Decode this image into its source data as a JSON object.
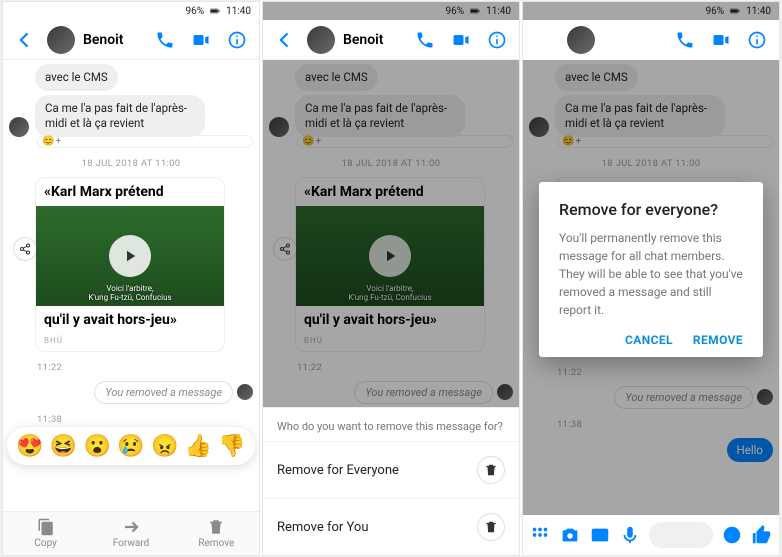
{
  "status": {
    "pct": "96%",
    "time": "11:40"
  },
  "contact": "Benoit",
  "msg": {
    "m1": "avec le CMS",
    "m2": "Ca me l'a pas fait de l'après-midi et là ça revient"
  },
  "ts1": "18 JUL 2018 AT 11:00",
  "card": {
    "top": "«Karl Marx prétend",
    "cap1": "Voici l'arbitre,",
    "cap2": "K'ung Fu-tzû, Confucius",
    "bot": "qu'il y avait hors-jeu»",
    "brand": "BHÜ"
  },
  "ts2": "11:22",
  "removed": "You removed a message",
  "ts3": "11:38",
  "hello": "Hello",
  "reactions": [
    "😍",
    "😆",
    "😮",
    "😢",
    "😠",
    "👍",
    "👎"
  ],
  "bbar": {
    "copy": "Copy",
    "forward": "Forward",
    "remove": "Remove"
  },
  "sheet": {
    "q": "Who do you want to remove this message for?",
    "r1": "Remove for Everyone",
    "r2": "Remove for You"
  },
  "dialog": {
    "title": "Remove for everyone?",
    "body": "You'll permanently remove this message for all chat members. They will be able to see that you've removed a message and still report it.",
    "cancel": "CANCEL",
    "remove": "REMOVE"
  }
}
